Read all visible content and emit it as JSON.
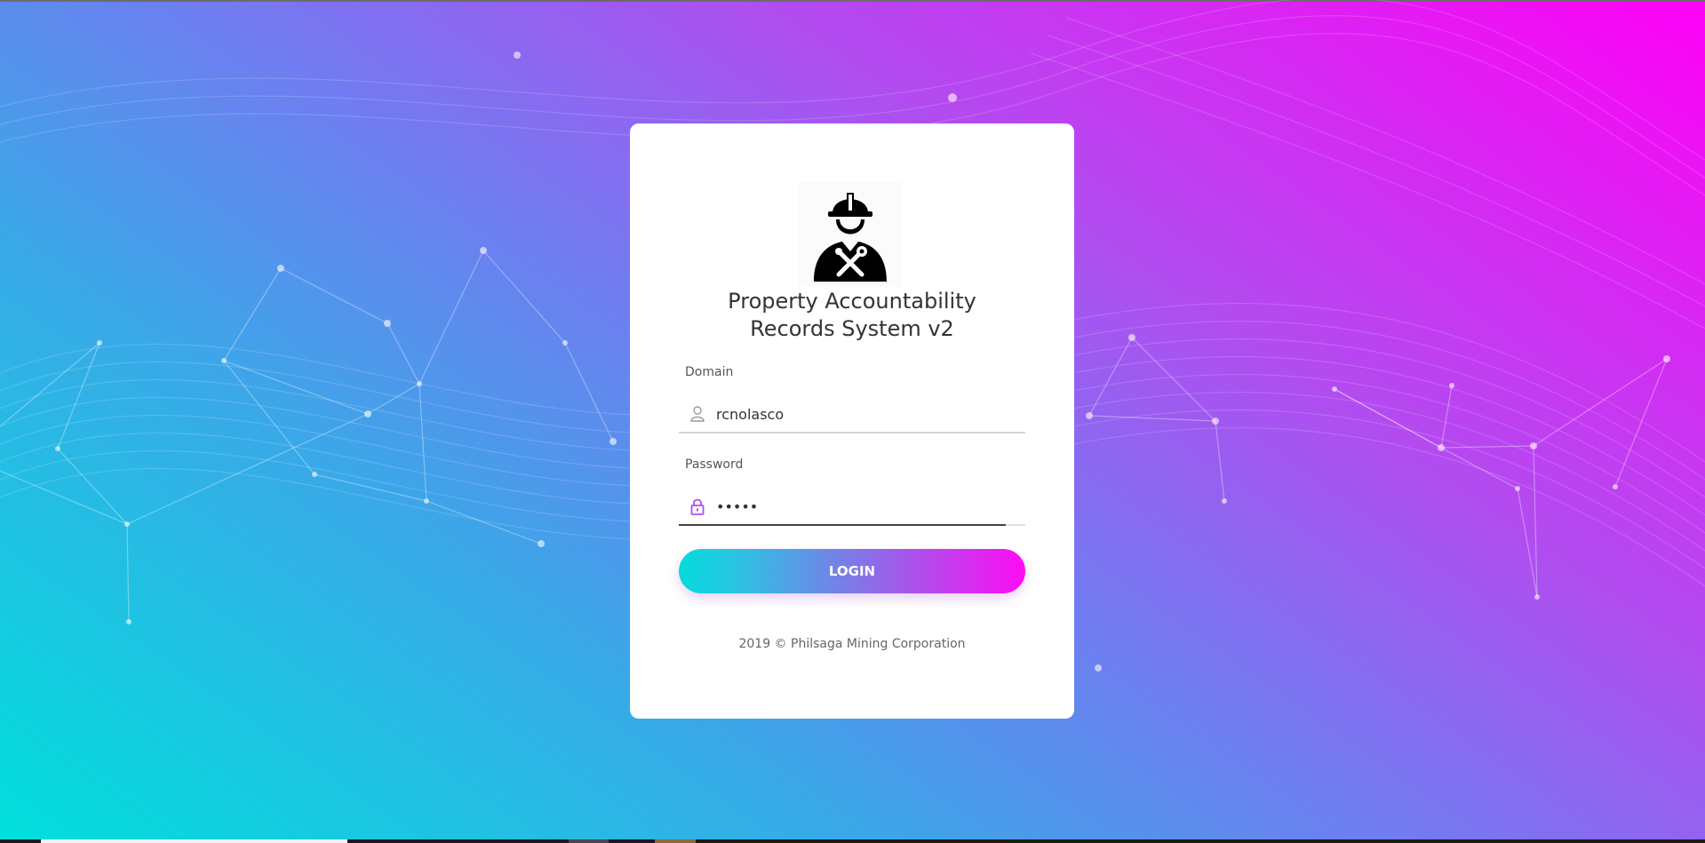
{
  "app": {
    "title_line1": "Property Accountability",
    "title_line2": "Records System v2",
    "logo_icon": "worker-with-tools-icon"
  },
  "form": {
    "domain_label": "Domain",
    "domain_value": "rcnolasco",
    "domain_icon": "user-icon",
    "password_label": "Password",
    "password_value": "•••••",
    "password_icon": "lock-icon",
    "login_label": "LOGIN"
  },
  "footer": {
    "text": "2019 © Philsaga Mining Corporation"
  },
  "colors": {
    "gradient_start": "#00e0dc",
    "gradient_end": "#ff00f6",
    "accent_icon": "#b24cf0"
  }
}
